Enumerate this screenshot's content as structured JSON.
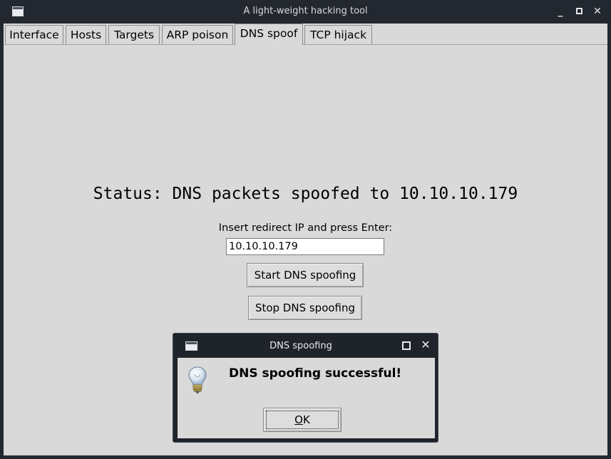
{
  "window": {
    "title": "A light-weight hacking tool",
    "controls": {
      "minimize": "_",
      "close": "✕"
    }
  },
  "tabs": [
    {
      "label": "Interface",
      "active": false
    },
    {
      "label": "Hosts",
      "active": false
    },
    {
      "label": "Targets",
      "active": false
    },
    {
      "label": "ARP poison",
      "active": false
    },
    {
      "label": "DNS spoof",
      "active": true
    },
    {
      "label": "TCP hijack",
      "active": false
    }
  ],
  "dns_spoof": {
    "status": "Status: DNS packets spoofed to 10.10.10.179",
    "redirect_label": "Insert redirect IP and press Enter:",
    "redirect_ip": "10.10.10.179",
    "start_button": "Start DNS spoofing",
    "stop_button": "Stop DNS spoofing"
  },
  "dialog": {
    "title": "DNS spoofing",
    "message": "DNS spoofing successful!",
    "ok_mnemonic": "O",
    "ok_rest": "K",
    "close": "✕",
    "icon": "lightbulb-icon"
  },
  "colors": {
    "titlebar": "#232830",
    "client_bg": "#d9d9d9",
    "dialog_frame": "#1f232a"
  }
}
